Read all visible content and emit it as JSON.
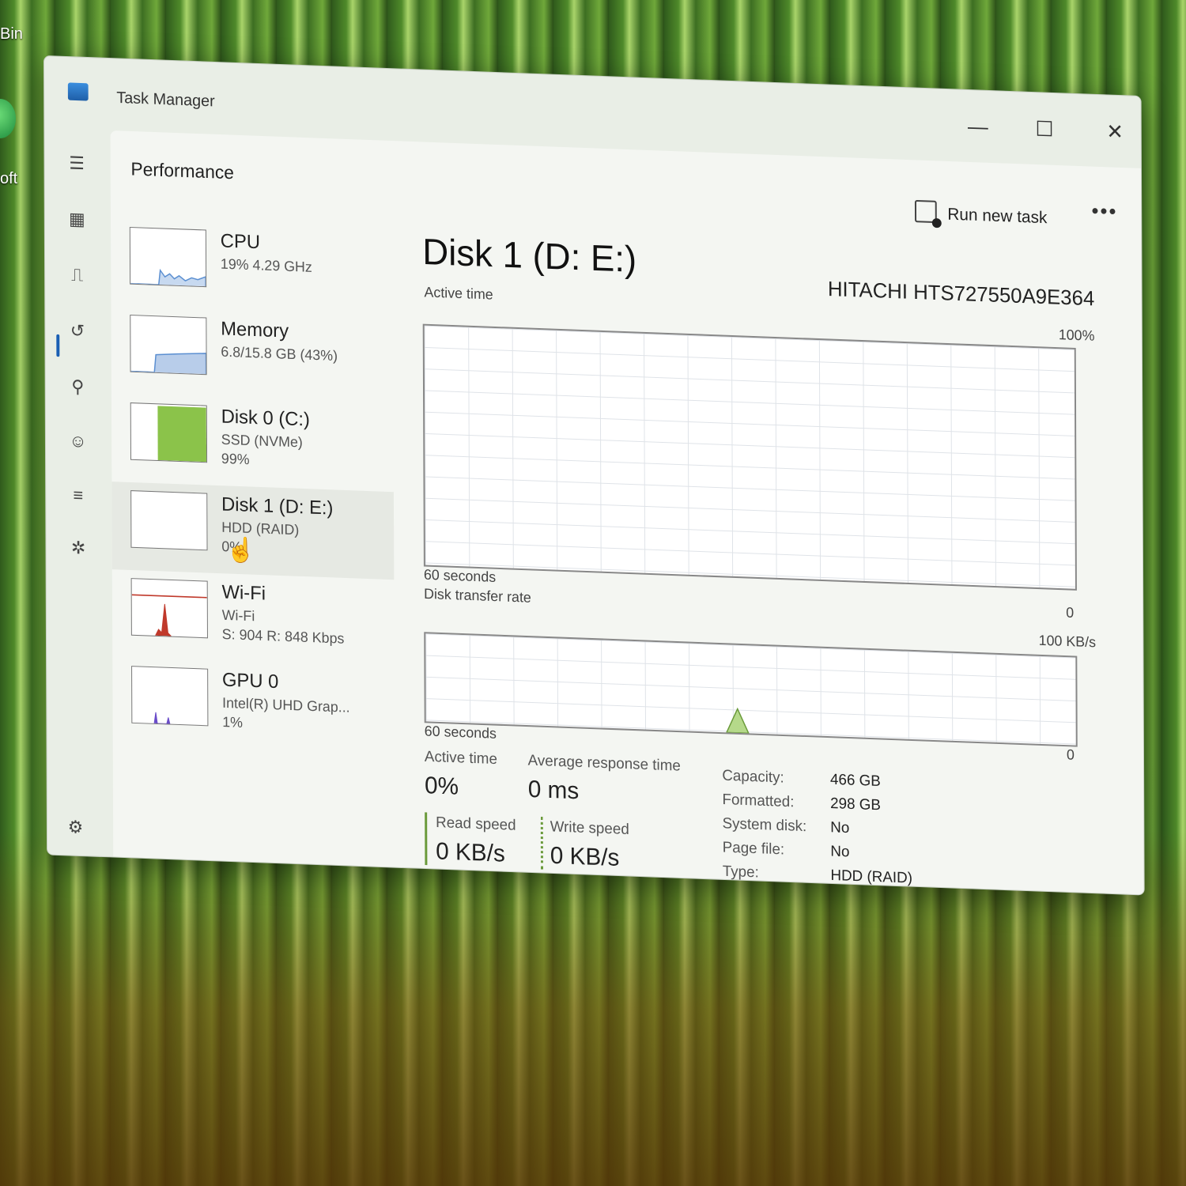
{
  "desktop": {
    "label_top": "Bin",
    "label_mid": "oft"
  },
  "window": {
    "title": "Task Manager",
    "min": "—",
    "max": "☐",
    "close": "✕"
  },
  "nav": {
    "icons": [
      "hamburger-menu-icon",
      "processes-icon",
      "performance-icon",
      "app-history-icon",
      "startup-apps-icon",
      "users-icon",
      "details-icon",
      "services-icon"
    ],
    "settings": "settings-icon"
  },
  "page": {
    "title": "Performance",
    "run_task": "Run new task",
    "more": "•••"
  },
  "sidebar": {
    "items": [
      {
        "name": "CPU",
        "sub1": "19%  4.29 GHz",
        "sub2": "",
        "sub3": ""
      },
      {
        "name": "Memory",
        "sub1": "6.8/15.8 GB (43%)",
        "sub2": "",
        "sub3": ""
      },
      {
        "name": "Disk 0 (C:)",
        "sub1": "SSD (NVMe)",
        "sub2": "99%",
        "sub3": ""
      },
      {
        "name": "Disk 1 (D: E:)",
        "sub1": "HDD (RAID)",
        "sub2": "0%",
        "sub3": ""
      },
      {
        "name": "Wi-Fi",
        "sub1": "Wi-Fi",
        "sub2": "S: 904  R: 848 Kbps",
        "sub3": ""
      },
      {
        "name": "GPU 0",
        "sub1": "Intel(R) UHD Grap...",
        "sub2": "1%",
        "sub3": ""
      }
    ]
  },
  "disk": {
    "title": "Disk 1 (D: E:)",
    "model": "HITACHI HTS727550A9E364",
    "graph1": {
      "label": "Active time",
      "max": "100%",
      "min": "0",
      "span": "60 seconds"
    },
    "graph2": {
      "label": "Disk transfer rate",
      "max": "100 KB/s",
      "min": "0",
      "span": "60 seconds"
    },
    "stats": {
      "active_label": "Active time",
      "active_value": "0%",
      "resp_label": "Average response time",
      "resp_value": "0 ms",
      "read_label": "Read speed",
      "read_value": "0 KB/s",
      "write_label": "Write speed",
      "write_value": "0 KB/s"
    },
    "props": [
      {
        "key": "Capacity:",
        "value": "466 GB"
      },
      {
        "key": "Formatted:",
        "value": "298 GB"
      },
      {
        "key": "System disk:",
        "value": "No"
      },
      {
        "key": "Page file:",
        "value": "No"
      },
      {
        "key": "Type:",
        "value": "HDD (RAID)"
      }
    ]
  },
  "colors": {
    "accent": "#1a5fb4",
    "disk_green": "#8bc34a",
    "cpu_blue": "#5b8fd1",
    "wifi_red": "#c0392b",
    "gpu_purple": "#6a4cc9"
  }
}
